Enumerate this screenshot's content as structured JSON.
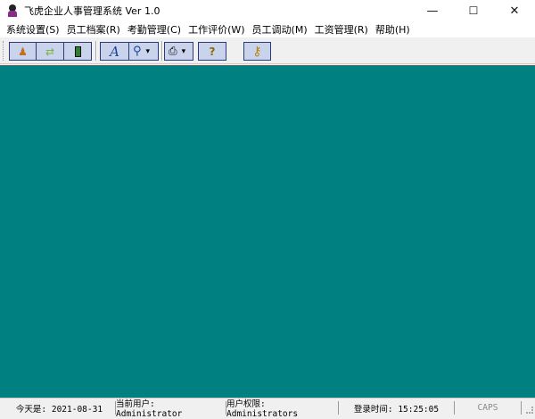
{
  "window": {
    "title": "飞虎企业人事管理系统 Ver 1.0",
    "minimize": "—",
    "maximize": "☐",
    "close": "✕"
  },
  "menu": [
    {
      "label": "系统设置(S)"
    },
    {
      "label": "员工档案(R)"
    },
    {
      "label": "考勤管理(C)"
    },
    {
      "label": "工作评价(W)"
    },
    {
      "label": "员工调动(M)"
    },
    {
      "label": "工资管理(R)"
    },
    {
      "label": "帮助(H)"
    }
  ],
  "toolbar": {
    "icons": [
      "user-icon",
      "exchange-icon",
      "exit-door-icon",
      "font-icon",
      "search-icon",
      "printer-icon",
      "help-icon",
      "key-icon"
    ],
    "dropdown": "▾"
  },
  "colors": {
    "workspace": "#008080",
    "button_bg": "#c9d3ec"
  },
  "status": {
    "date": "今天是: 2021-08-31",
    "user": "当前用户: Administrator",
    "role": "用户权限: Administrators",
    "login": "登录时间: 15:25:05",
    "caps": "CAPS"
  }
}
